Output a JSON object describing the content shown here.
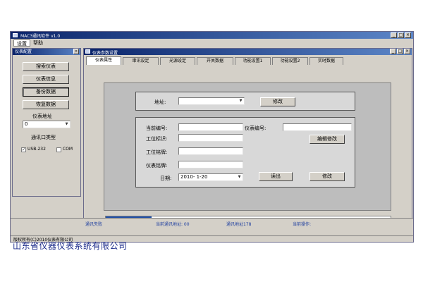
{
  "window": {
    "title": "MAC3通讯软件 v1.0"
  },
  "menu": {
    "items": [
      "设置",
      "帮助"
    ]
  },
  "left_panel": {
    "title": "仪表配置",
    "buttons": [
      "搜索仪表",
      "仪表信息",
      "备份数据",
      "恢复数据"
    ],
    "pressed_index": 2,
    "address_label": "仪表地址",
    "address_value": "0",
    "comm_type_label": "通讯口类型",
    "options": [
      {
        "label": "USB-232",
        "checked": true
      },
      {
        "label": "COM",
        "checked": false
      }
    ]
  },
  "child": {
    "title": "仪表参数设置",
    "tabs": [
      "仪表属性",
      "串讯设定",
      "光源设定",
      "开关数据",
      "功能设置1",
      "功能设置2",
      "实时数据"
    ],
    "active_tab": 0,
    "address_label": "地址:",
    "address_value": "",
    "modify_button": "修改",
    "fields": {
      "left": [
        "当前编号:",
        "工位标识:",
        "工位铭牌:",
        "仪表铭牌:"
      ],
      "meter_code_label": "仪表编号:",
      "edit_code_button": "编辑修改",
      "date_label": "日期:",
      "date_value": "2010- 1-20",
      "read_button": "读出",
      "write_button": "修改"
    },
    "progress": 0.16
  },
  "status": {
    "items": [
      "通讯失败",
      "当前通讯地址: 00",
      "通讯地址178",
      "当前操作:"
    ]
  },
  "bottom_status": "版权所有(C)2010仪表有限公司",
  "caption": "山东省仪器仪表系统有限公司",
  "colors": {
    "titlebar": "#0a246a",
    "progress": "#2050a8",
    "status_text": "#2040a0"
  }
}
